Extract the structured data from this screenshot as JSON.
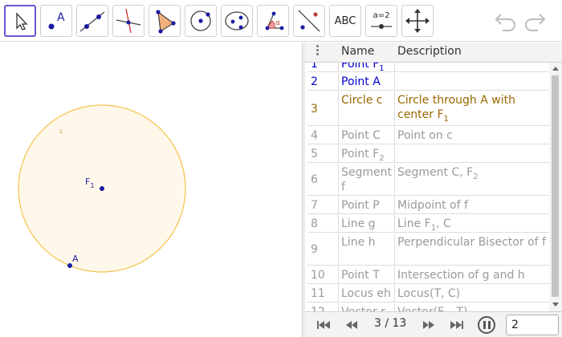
{
  "toolbar": {
    "tools": [
      {
        "name": "move-tool",
        "selected": true
      },
      {
        "name": "point-tool"
      },
      {
        "name": "line-tool"
      },
      {
        "name": "perpendicular-line-tool"
      },
      {
        "name": "polygon-tool"
      },
      {
        "name": "circle-with-center-tool"
      },
      {
        "name": "ellipse-tool"
      },
      {
        "name": "angle-tool"
      },
      {
        "name": "reflect-about-line-tool"
      },
      {
        "name": "text-tool",
        "label": "ABC"
      },
      {
        "name": "slider-tool",
        "label": "a=2"
      },
      {
        "name": "move-graphics-view-tool"
      }
    ],
    "undo_icon": "undo-icon",
    "redo_icon": "redo-icon"
  },
  "graphics": {
    "circle_label": "c",
    "center_label": "F",
    "center_subscript": "1",
    "point_label": "A",
    "circle_fill": "#fff8ea",
    "circle_stroke": "#f5c34a",
    "point_color": "#1a1aa0"
  },
  "protocol": {
    "headers": {
      "name": "Name",
      "description": "Description"
    },
    "rows": [
      {
        "num": "1",
        "name": "Point F",
        "name_sub": "1",
        "desc": "",
        "desc_sub": "",
        "desc_tail": ""
      },
      {
        "num": "2",
        "name": "Point A",
        "name_sub": "",
        "desc": "",
        "desc_sub": "",
        "desc_tail": ""
      },
      {
        "num": "3",
        "name": "Circle c",
        "name_sub": "",
        "desc": "Circle through A with center F",
        "desc_sub": "1",
        "desc_tail": ""
      },
      {
        "num": "4",
        "name": "Point C",
        "name_sub": "",
        "desc": "Point on c",
        "desc_sub": "",
        "desc_tail": ""
      },
      {
        "num": "5",
        "name": "Point F",
        "name_sub": "2",
        "desc": "",
        "desc_sub": "",
        "desc_tail": ""
      },
      {
        "num": "6",
        "name": "Segment f",
        "name_sub": "",
        "desc": "Segment C, F",
        "desc_sub": "2",
        "desc_tail": ""
      },
      {
        "num": "7",
        "name": "Point P",
        "name_sub": "",
        "desc": "Midpoint of f",
        "desc_sub": "",
        "desc_tail": ""
      },
      {
        "num": "8",
        "name": "Line g",
        "name_sub": "",
        "desc": "Line F",
        "desc_sub": "1",
        "desc_tail": ", C"
      },
      {
        "num": "9",
        "name": "Line h",
        "name_sub": "",
        "desc": "Perpendicular Bisector of f",
        "desc_sub": "",
        "desc_tail": ""
      },
      {
        "num": "10",
        "name": "Point T",
        "name_sub": "",
        "desc": "Intersection of g and h",
        "desc_sub": "",
        "desc_tail": ""
      },
      {
        "num": "11",
        "name": "Locus eh",
        "name_sub": "",
        "desc": "Locus(T, C)",
        "desc_sub": "",
        "desc_tail": ""
      },
      {
        "num": "12",
        "name": "Vector r",
        "name_sub": "1",
        "desc": "Vector(F",
        "desc_sub": "1",
        "desc_tail": ", T)"
      }
    ],
    "colors": {
      "current": "#0000cc",
      "highlight": "#996600",
      "hidden": "#9a9a9a"
    }
  },
  "navigation": {
    "step": "3 / 13",
    "speed_value": "2",
    "first_icon": "skip-first-icon",
    "prev_icon": "step-back-icon",
    "next_icon": "step-forward-icon",
    "last_icon": "skip-last-icon",
    "pause_icon": "pause-icon"
  }
}
